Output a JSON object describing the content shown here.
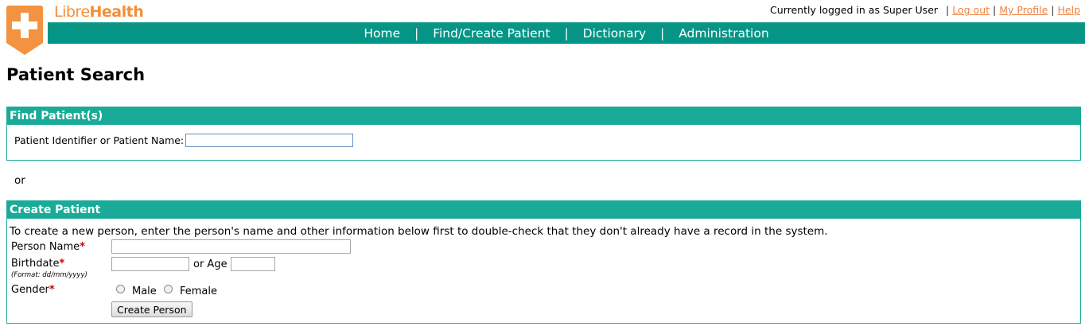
{
  "brand": {
    "name_light": "Libre",
    "name_bold": "Health",
    "logo_color": "#f28f3b"
  },
  "user_bar": {
    "status_text": "Currently logged in as Super User",
    "links": [
      "Log out",
      "My Profile",
      "Help"
    ]
  },
  "nav": {
    "items": [
      "Home",
      "Find/Create Patient",
      "Dictionary",
      "Administration"
    ],
    "color": "#009688"
  },
  "page": {
    "title": "Patient Search"
  },
  "find": {
    "header": "Find Patient(s)",
    "label": "Patient Identifier or Patient Name:",
    "value": ""
  },
  "or_text": "or",
  "create": {
    "header": "Create Patient",
    "intro": "To create a new person, enter the person's name and other information below first to double-check that they don't already have a record in the system.",
    "person_name_label": "Person Name",
    "birthdate_label": "Birthdate",
    "birthdate_format": "(Format: dd/mm/yyyy)",
    "or_age_label": "or Age",
    "gender_label": "Gender",
    "male_label": "Male",
    "female_label": "Female",
    "required_marker": "*",
    "submit_label": "Create Person"
  },
  "colors": {
    "accent": "#1aab98",
    "link": "#f08040",
    "required": "#cc0000"
  }
}
